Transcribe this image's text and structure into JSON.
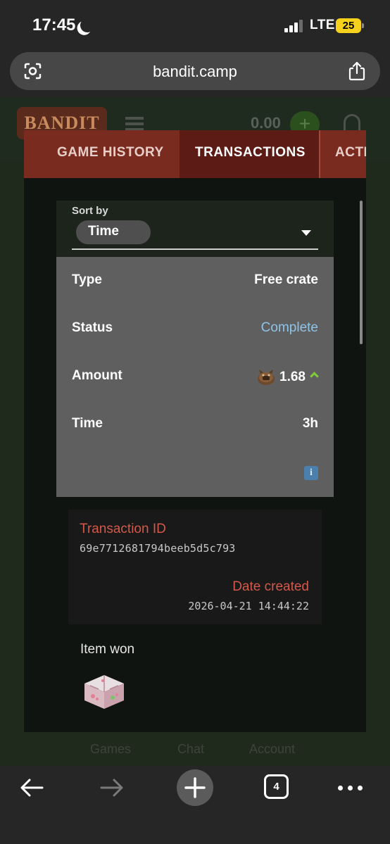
{
  "status_bar": {
    "time": "17:45",
    "network": "LTE",
    "battery": "25"
  },
  "browser": {
    "url": "bandit.camp",
    "tab_count": "4"
  },
  "site": {
    "logo_text": "BANDIT",
    "balance": "0.00",
    "add_label": "+",
    "bottom_nav": [
      "Games",
      "Chat",
      "Account"
    ]
  },
  "modal": {
    "tabs": [
      {
        "label": "GAME HISTORY",
        "active": false
      },
      {
        "label": "TRANSACTIONS",
        "active": true
      },
      {
        "label": "ACTI",
        "active": false
      }
    ],
    "sort": {
      "label": "Sort by",
      "value": "Time"
    },
    "details": {
      "type_label": "Type",
      "type_value": "Free crate",
      "status_label": "Status",
      "status_value": "Complete",
      "amount_label": "Amount",
      "amount_value": "1.68",
      "time_label": "Time",
      "time_value": "3h",
      "info_glyph": "i"
    },
    "transaction": {
      "id_label": "Transaction ID",
      "id_value": "69e7712681794beeb5d5c793",
      "date_label": "Date created",
      "date_value": "2026-04-21 14:44:22"
    },
    "item_won_label": "Item won"
  },
  "colors": {
    "tab_bar": "#7a2b20",
    "tab_active": "#5c1b14",
    "status_complete": "#8fc3e8",
    "accent_red": "#d5584a",
    "battery": "#f6d21c"
  },
  "icons": [
    "moon-icon",
    "signal-icon",
    "scan-icon",
    "share-icon",
    "coin-icon",
    "chevron-up-icon",
    "info-icon",
    "crate-icon",
    "back-icon",
    "forward-icon",
    "plus-icon",
    "more-icon"
  ]
}
